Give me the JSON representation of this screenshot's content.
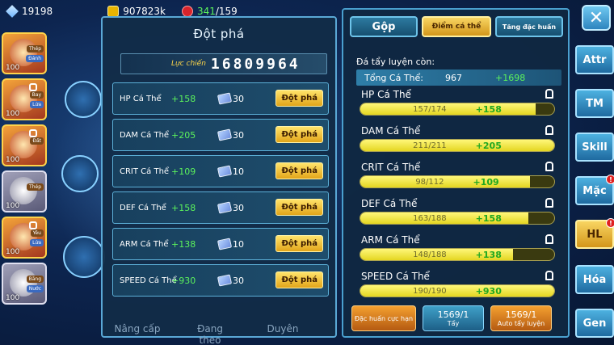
{
  "resources": {
    "gems": "19198",
    "gold": "907823k",
    "fruit_current": "341",
    "fruit_max": "/159"
  },
  "characters": [
    {
      "level": "100",
      "tag1": "Thép",
      "tag2": "Đánh"
    },
    {
      "level": "100",
      "tag1": "Bay",
      "tag2": "Lửa"
    },
    {
      "level": "100",
      "tag1": "Đất",
      "tag2": ""
    },
    {
      "level": "100",
      "tag1": "Thép",
      "tag2": ""
    },
    {
      "level": "100",
      "tag1": "Yêu",
      "tag2": "Lửa"
    },
    {
      "level": "100",
      "tag1": "Băng",
      "tag2": "Nước"
    }
  ],
  "breakthrough": {
    "title": "Đột phá",
    "power_label": "Lực chiến",
    "power_value": "16809964",
    "button_label": "Đột phá",
    "stats": [
      {
        "name": "HP Cá Thể",
        "bonus": "+158",
        "count": "30"
      },
      {
        "name": "DAM Cá Thể",
        "bonus": "+205",
        "count": "30"
      },
      {
        "name": "CRIT Cá Thể",
        "bonus": "+109",
        "count": "10"
      },
      {
        "name": "DEF Cá Thể",
        "bonus": "+158",
        "count": "30"
      },
      {
        "name": "ARM Cá Thể",
        "bonus": "+138",
        "count": "10"
      },
      {
        "name": "SPEED Cá Thể",
        "bonus": "+930",
        "count": "30"
      }
    ]
  },
  "bottom_nav": [
    "Nâng cấp",
    "Đang theo",
    "Duyên"
  ],
  "training": {
    "tabs": {
      "merge": "Gộp",
      "individual": "Điểm cá thể",
      "special": "Tăng đặc huấn"
    },
    "remaining_label": "Đá tẩy luyện còn:",
    "total_label": "Tổng Cá Thể:",
    "total_value": "967",
    "total_bonus": "+1698",
    "stats": [
      {
        "name": "HP Cá Thể",
        "current": 157,
        "max": 174,
        "progress": "157/174",
        "bonus": "+158"
      },
      {
        "name": "DAM Cá Thể",
        "current": 211,
        "max": 211,
        "progress": "211/211",
        "bonus": "+205"
      },
      {
        "name": "CRIT Cá Thể",
        "current": 98,
        "max": 112,
        "progress": "98/112",
        "bonus": "+109"
      },
      {
        "name": "DEF Cá Thể",
        "current": 163,
        "max": 188,
        "progress": "163/188",
        "bonus": "+158"
      },
      {
        "name": "ARM Cá Thể",
        "current": 148,
        "max": 188,
        "progress": "148/188",
        "bonus": "+138"
      },
      {
        "name": "SPEED Cá Thể",
        "current": 190,
        "max": 190,
        "progress": "190/190",
        "bonus": "+930"
      }
    ],
    "buttons": {
      "ultimate": "Đặc huấn cực hạn",
      "wash_count": "1569/1",
      "wash": "Tẩy",
      "auto_count": "1569/1",
      "auto": "Auto tẩy luyện"
    }
  },
  "menu": [
    "Attr",
    "TM",
    "Skill",
    "Mặc",
    "HL",
    "Hóa",
    "Gen"
  ],
  "menu_badges": {
    "Mặc": "!",
    "HL": "!"
  },
  "colors": {
    "accent_green": "#5cf35c",
    "gold": "#e2a51a",
    "panel_border": "#5aa8d6"
  }
}
